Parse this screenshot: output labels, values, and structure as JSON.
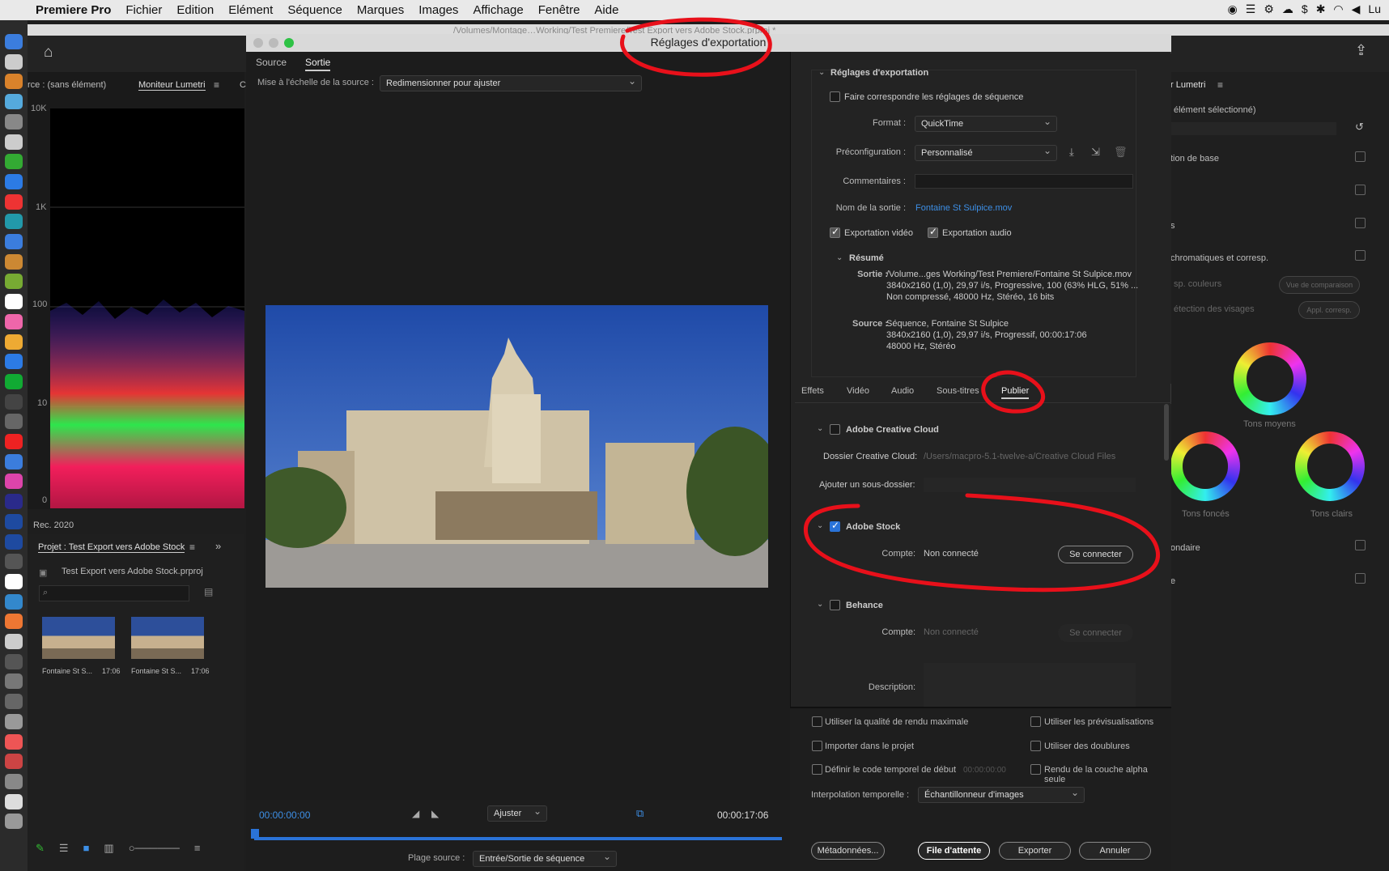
{
  "menubar": {
    "apple": "",
    "app_name": "Premiere Pro",
    "items": [
      "Fichier",
      "Edition",
      "Elément",
      "Séquence",
      "Marques",
      "Images",
      "Affichage",
      "Fenêtre",
      "Aide"
    ],
    "clock_partial": "Lu"
  },
  "window": {
    "path_title": "/Volumes/Montage…Working/Test Premiere/Test Export vers Adobe Stock.prproj *"
  },
  "left_panel": {
    "source_tab": "rce : (sans élément)",
    "lumetri_tab": "Moniteur Lumetri",
    "extra_tab": "C",
    "y_labels": [
      "10K",
      "1K",
      "100",
      "10",
      "0"
    ],
    "footer": "Rec. 2020"
  },
  "project_panel": {
    "title": "Projet : Test Export vers Adobe Stock",
    "file_name": "Test Export vers Adobe Stock.prproj",
    "clips": [
      {
        "name": "Fontaine St S...",
        "duration": "17:06"
      },
      {
        "name": "Fontaine St S...",
        "duration": "17:06"
      }
    ]
  },
  "right_panel": {
    "title": "r Lumetri",
    "subtitle": "élément sélectionné)",
    "rows": [
      "tion de base",
      "s",
      "chromatiques et corresp.",
      "ondaire",
      "e"
    ],
    "sp_couleurs": "sp. couleurs",
    "vue_comparaison": "Vue de comparaison",
    "detection": "étection des visages",
    "appl_corresp": "Appl. corresp.",
    "wheels": [
      "Tons moyens",
      "Tons foncés",
      "Tons clairs"
    ]
  },
  "dialog": {
    "title": "Réglages d'exportation",
    "tab_source": "Source",
    "tab_output": "Sortie",
    "scale_label": "Mise à l'échelle de la source :",
    "scale_value": "Redimensionner pour ajuster",
    "timecode_start": "00:00:00:00",
    "timecode_end": "00:00:17:06",
    "fit_value": "Ajuster",
    "source_range_label": "Plage source :",
    "source_range_value": "Entrée/Sortie de séquence",
    "settings": {
      "header": "Réglages d'exportation",
      "match_seq": "Faire correspondre les réglages de séquence",
      "format_label": "Format :",
      "format_value": "QuickTime",
      "preset_label": "Préconfiguration :",
      "preset_value": "Personnalisé",
      "comments_label": "Commentaires :",
      "output_name_label": "Nom de la sortie :",
      "output_name_value": "Fontaine St Sulpice.mov",
      "export_video": "Exportation vidéo",
      "export_audio": "Exportation audio",
      "summary": "Résumé",
      "output_label": "Sortie :",
      "output_line1": "/Volume...ges Working/Test Premiere/Fontaine St Sulpice.mov",
      "output_line2": "3840x2160 (1,0), 29,97 i/s, Progressive, 100 (63% HLG, 51% ...",
      "output_line3": "Non compressé, 48000  Hz, Stéréo, 16 bits",
      "source_label": "Source :",
      "source_line1": "Séquence, Fontaine St Sulpice",
      "source_line2": "3840x2160 (1,0), 29,97  i/s, Progressif, 00:00:17:06",
      "source_line3": "48000 Hz, Stéréo"
    },
    "subtabs": [
      "Effets",
      "Vidéo",
      "Audio",
      "Sous-titres",
      "Publier"
    ],
    "publish": {
      "cc_title": "Adobe Creative Cloud",
      "cc_folder_label": "Dossier Creative Cloud:",
      "cc_folder_value": "/Users/macpro-5.1-twelve-a/Creative Cloud Files",
      "subfolder_label": "Ajouter un sous-dossier:",
      "stock_title": "Adobe Stock",
      "account_label": "Compte:",
      "account_value": "Non connecté",
      "connect": "Se connecter",
      "behance_title": "Behance",
      "behance_account_label": "Compte:",
      "behance_account_value": "Non connecté",
      "behance_connect": "Se connecter",
      "description_label": "Description:"
    },
    "bottom": {
      "max_quality": "Utiliser la qualité de rendu maximale",
      "use_previews": "Utiliser les prévisualisations",
      "import_project": "Importer dans le projet",
      "use_proxies": "Utiliser des doublures",
      "set_timecode": "Définir le code temporel de début",
      "timecode_value": "00:00:00:00",
      "alpha_only": "Rendu de la couche alpha seule",
      "interp_label": "Interpolation temporelle :",
      "interp_value": "Échantillonneur d'images",
      "metadata": "Métadonnées...",
      "queue": "File d'attente",
      "export": "Exporter",
      "cancel": "Annuler"
    }
  },
  "colors": {
    "accent_blue": "#3d8fe6",
    "annotation_red": "#e8101a"
  }
}
